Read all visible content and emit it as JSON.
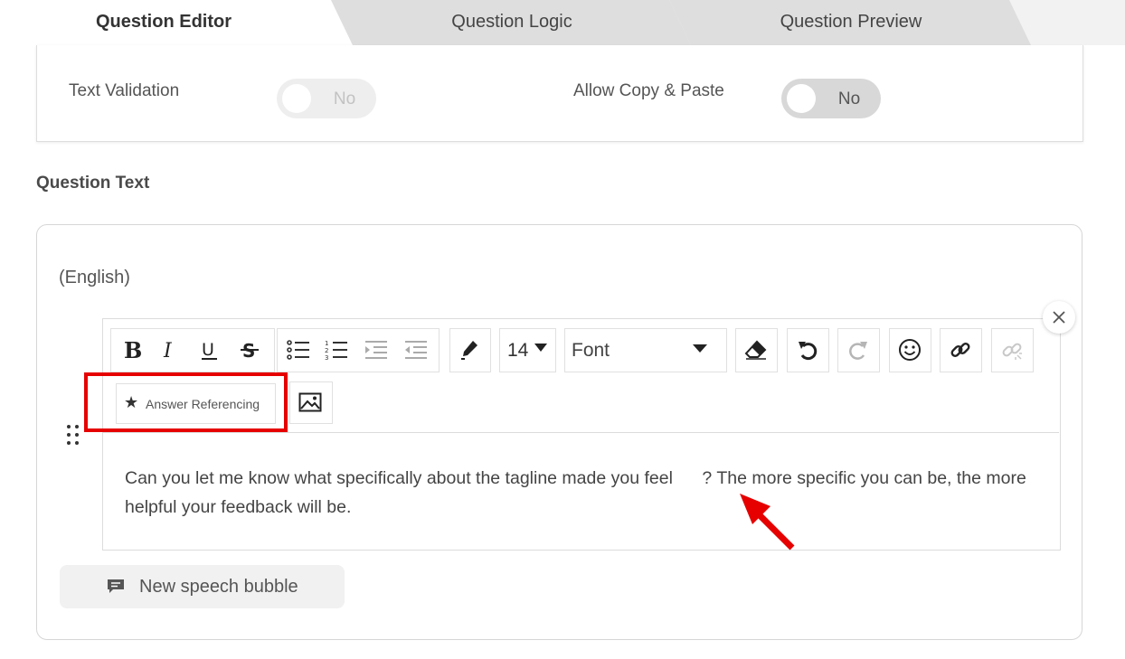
{
  "tabs": [
    {
      "label": "Question Editor",
      "active": true
    },
    {
      "label": "Question Logic",
      "active": false
    },
    {
      "label": "Question Preview",
      "active": false
    }
  ],
  "settings": {
    "text_validation": {
      "label": "Text Validation",
      "value": "No",
      "enabled": false
    },
    "allow_copy_paste": {
      "label": "Allow Copy & Paste",
      "value": "No",
      "enabled": true
    }
  },
  "question_text": {
    "section_title": "Question Text",
    "language": "(English)",
    "toolbar": {
      "font_size": "14",
      "font_name": "Font",
      "answer_referencing": "Answer Referencing"
    },
    "body": "Can you let me know what specifically about the tagline made you feel      ? The more specific you can be, the more helpful your feedback will be."
  },
  "speech_bubble_button": "New speech bubble",
  "colors": {
    "highlight": "#e60000",
    "arrow": "#e60000",
    "tab_inactive": "#dedede",
    "toggle_on": "#d8d8d8"
  },
  "icons": [
    "bold-icon",
    "italic-icon",
    "underline-icon",
    "strikethrough-icon",
    "bulleted-list-icon",
    "numbered-list-icon",
    "indent-icon",
    "outdent-icon",
    "text-color-pen-icon",
    "dropdown-caret-icon",
    "eraser-icon",
    "undo-icon",
    "redo-icon",
    "emoji-icon",
    "link-icon",
    "unlink-icon",
    "star-icon",
    "image-icon",
    "close-icon",
    "drag-handle-icon",
    "speech-bubble-icon",
    "arrow-pointer-icon"
  ]
}
